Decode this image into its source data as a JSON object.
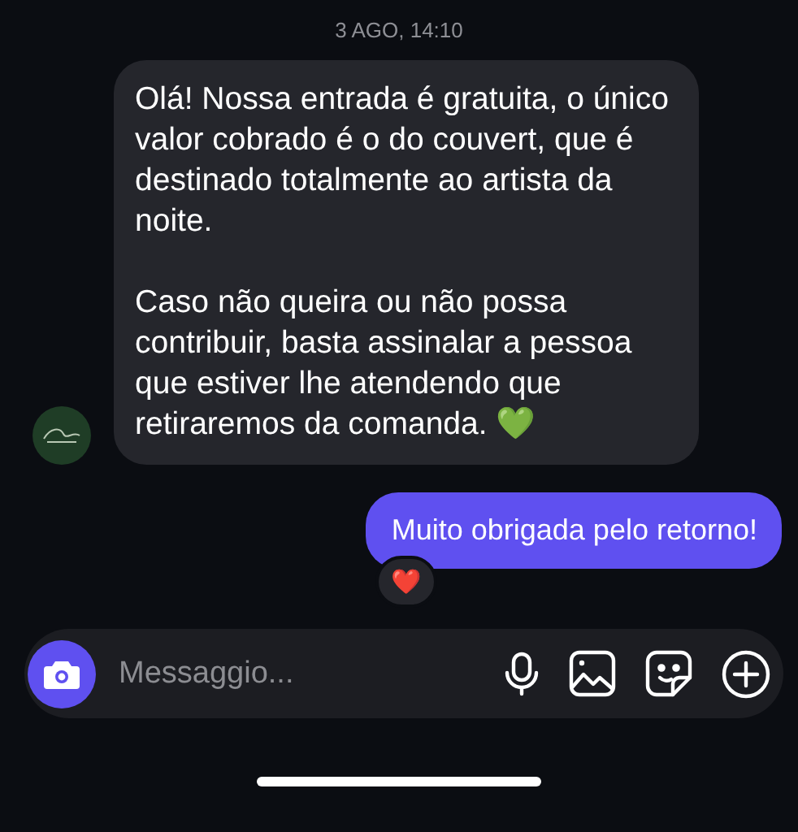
{
  "timestamp": "3 AGO, 14:10",
  "messages": [
    {
      "kind": "incoming",
      "paragraphs": [
        "Olá! Nossa entrada é gratuita, o único valor cobrado é o do couvert, que é destinado totalmente ao artista da noite.",
        "Caso não queira ou não possa contribuir, basta assinalar a pessoa que estiver lhe atendendo que retiraremos da comanda. 💚"
      ]
    },
    {
      "kind": "outgoing",
      "paragraphs": [
        "Muito obrigada pelo retorno!"
      ],
      "reaction": "❤️"
    }
  ],
  "composer": {
    "placeholder": "Messaggio..."
  }
}
